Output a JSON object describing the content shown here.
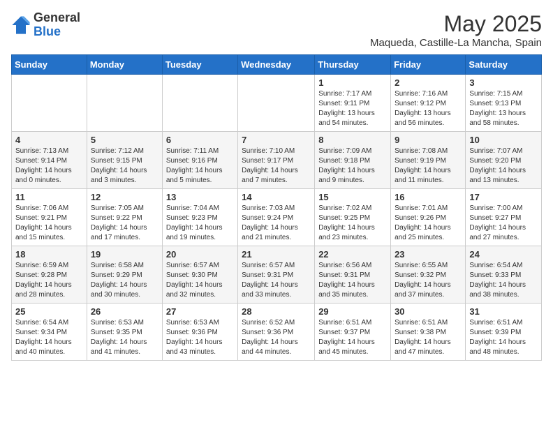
{
  "logo": {
    "general": "General",
    "blue": "Blue"
  },
  "title": "May 2025",
  "location": "Maqueda, Castille-La Mancha, Spain",
  "weekdays": [
    "Sunday",
    "Monday",
    "Tuesday",
    "Wednesday",
    "Thursday",
    "Friday",
    "Saturday"
  ],
  "weeks": [
    [
      {
        "day": "",
        "sunrise": "",
        "sunset": "",
        "daylight": ""
      },
      {
        "day": "",
        "sunrise": "",
        "sunset": "",
        "daylight": ""
      },
      {
        "day": "",
        "sunrise": "",
        "sunset": "",
        "daylight": ""
      },
      {
        "day": "",
        "sunrise": "",
        "sunset": "",
        "daylight": ""
      },
      {
        "day": "1",
        "sunrise": "Sunrise: 7:17 AM",
        "sunset": "Sunset: 9:11 PM",
        "daylight": "Daylight: 13 hours and 54 minutes."
      },
      {
        "day": "2",
        "sunrise": "Sunrise: 7:16 AM",
        "sunset": "Sunset: 9:12 PM",
        "daylight": "Daylight: 13 hours and 56 minutes."
      },
      {
        "day": "3",
        "sunrise": "Sunrise: 7:15 AM",
        "sunset": "Sunset: 9:13 PM",
        "daylight": "Daylight: 13 hours and 58 minutes."
      }
    ],
    [
      {
        "day": "4",
        "sunrise": "Sunrise: 7:13 AM",
        "sunset": "Sunset: 9:14 PM",
        "daylight": "Daylight: 14 hours and 0 minutes."
      },
      {
        "day": "5",
        "sunrise": "Sunrise: 7:12 AM",
        "sunset": "Sunset: 9:15 PM",
        "daylight": "Daylight: 14 hours and 3 minutes."
      },
      {
        "day": "6",
        "sunrise": "Sunrise: 7:11 AM",
        "sunset": "Sunset: 9:16 PM",
        "daylight": "Daylight: 14 hours and 5 minutes."
      },
      {
        "day": "7",
        "sunrise": "Sunrise: 7:10 AM",
        "sunset": "Sunset: 9:17 PM",
        "daylight": "Daylight: 14 hours and 7 minutes."
      },
      {
        "day": "8",
        "sunrise": "Sunrise: 7:09 AM",
        "sunset": "Sunset: 9:18 PM",
        "daylight": "Daylight: 14 hours and 9 minutes."
      },
      {
        "day": "9",
        "sunrise": "Sunrise: 7:08 AM",
        "sunset": "Sunset: 9:19 PM",
        "daylight": "Daylight: 14 hours and 11 minutes."
      },
      {
        "day": "10",
        "sunrise": "Sunrise: 7:07 AM",
        "sunset": "Sunset: 9:20 PM",
        "daylight": "Daylight: 14 hours and 13 minutes."
      }
    ],
    [
      {
        "day": "11",
        "sunrise": "Sunrise: 7:06 AM",
        "sunset": "Sunset: 9:21 PM",
        "daylight": "Daylight: 14 hours and 15 minutes."
      },
      {
        "day": "12",
        "sunrise": "Sunrise: 7:05 AM",
        "sunset": "Sunset: 9:22 PM",
        "daylight": "Daylight: 14 hours and 17 minutes."
      },
      {
        "day": "13",
        "sunrise": "Sunrise: 7:04 AM",
        "sunset": "Sunset: 9:23 PM",
        "daylight": "Daylight: 14 hours and 19 minutes."
      },
      {
        "day": "14",
        "sunrise": "Sunrise: 7:03 AM",
        "sunset": "Sunset: 9:24 PM",
        "daylight": "Daylight: 14 hours and 21 minutes."
      },
      {
        "day": "15",
        "sunrise": "Sunrise: 7:02 AM",
        "sunset": "Sunset: 9:25 PM",
        "daylight": "Daylight: 14 hours and 23 minutes."
      },
      {
        "day": "16",
        "sunrise": "Sunrise: 7:01 AM",
        "sunset": "Sunset: 9:26 PM",
        "daylight": "Daylight: 14 hours and 25 minutes."
      },
      {
        "day": "17",
        "sunrise": "Sunrise: 7:00 AM",
        "sunset": "Sunset: 9:27 PM",
        "daylight": "Daylight: 14 hours and 27 minutes."
      }
    ],
    [
      {
        "day": "18",
        "sunrise": "Sunrise: 6:59 AM",
        "sunset": "Sunset: 9:28 PM",
        "daylight": "Daylight: 14 hours and 28 minutes."
      },
      {
        "day": "19",
        "sunrise": "Sunrise: 6:58 AM",
        "sunset": "Sunset: 9:29 PM",
        "daylight": "Daylight: 14 hours and 30 minutes."
      },
      {
        "day": "20",
        "sunrise": "Sunrise: 6:57 AM",
        "sunset": "Sunset: 9:30 PM",
        "daylight": "Daylight: 14 hours and 32 minutes."
      },
      {
        "day": "21",
        "sunrise": "Sunrise: 6:57 AM",
        "sunset": "Sunset: 9:31 PM",
        "daylight": "Daylight: 14 hours and 33 minutes."
      },
      {
        "day": "22",
        "sunrise": "Sunrise: 6:56 AM",
        "sunset": "Sunset: 9:31 PM",
        "daylight": "Daylight: 14 hours and 35 minutes."
      },
      {
        "day": "23",
        "sunrise": "Sunrise: 6:55 AM",
        "sunset": "Sunset: 9:32 PM",
        "daylight": "Daylight: 14 hours and 37 minutes."
      },
      {
        "day": "24",
        "sunrise": "Sunrise: 6:54 AM",
        "sunset": "Sunset: 9:33 PM",
        "daylight": "Daylight: 14 hours and 38 minutes."
      }
    ],
    [
      {
        "day": "25",
        "sunrise": "Sunrise: 6:54 AM",
        "sunset": "Sunset: 9:34 PM",
        "daylight": "Daylight: 14 hours and 40 minutes."
      },
      {
        "day": "26",
        "sunrise": "Sunrise: 6:53 AM",
        "sunset": "Sunset: 9:35 PM",
        "daylight": "Daylight: 14 hours and 41 minutes."
      },
      {
        "day": "27",
        "sunrise": "Sunrise: 6:53 AM",
        "sunset": "Sunset: 9:36 PM",
        "daylight": "Daylight: 14 hours and 43 minutes."
      },
      {
        "day": "28",
        "sunrise": "Sunrise: 6:52 AM",
        "sunset": "Sunset: 9:36 PM",
        "daylight": "Daylight: 14 hours and 44 minutes."
      },
      {
        "day": "29",
        "sunrise": "Sunrise: 6:51 AM",
        "sunset": "Sunset: 9:37 PM",
        "daylight": "Daylight: 14 hours and 45 minutes."
      },
      {
        "day": "30",
        "sunrise": "Sunrise: 6:51 AM",
        "sunset": "Sunset: 9:38 PM",
        "daylight": "Daylight: 14 hours and 47 minutes."
      },
      {
        "day": "31",
        "sunrise": "Sunrise: 6:51 AM",
        "sunset": "Sunset: 9:39 PM",
        "daylight": "Daylight: 14 hours and 48 minutes."
      }
    ]
  ]
}
